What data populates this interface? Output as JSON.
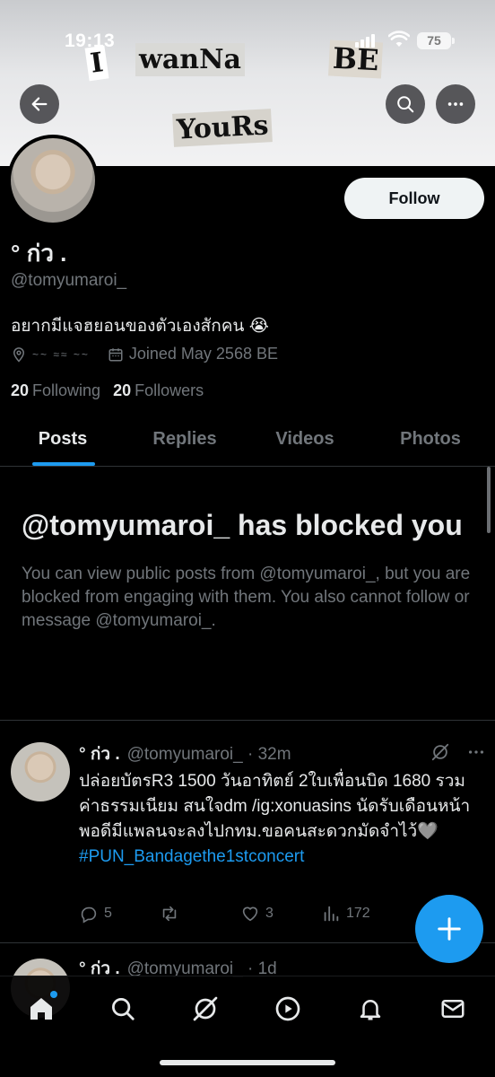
{
  "status_bar": {
    "time": "19:13",
    "battery": "75"
  },
  "banner": {
    "words": [
      "I",
      "wanna",
      "BE",
      "yours"
    ],
    "display": [
      "I",
      "wanNa",
      "BE",
      "YouRs"
    ]
  },
  "profile": {
    "name": "° ก่ว .",
    "handle": "@tomyumaroi_",
    "bio": "อยากมีแจฮยอนของตัวเองสักคน 😭",
    "location": "~~ ≈≈ ~~",
    "joined": "Joined May 2568 BE",
    "following_count": "20",
    "following_label": "Following",
    "followers_count": "20",
    "followers_label": "Followers",
    "follow_label": "Follow"
  },
  "tabs": [
    {
      "label": "Posts",
      "active": true
    },
    {
      "label": "Replies",
      "active": false
    },
    {
      "label": "Videos",
      "active": false
    },
    {
      "label": "Photos",
      "active": false
    }
  ],
  "blocked": {
    "title": "@tomyumaroi_ has blocked you",
    "message": "You can view public posts from @tomyumaroi_, but you are blocked from engaging with them. You also cannot follow or message @tomyumaroi_."
  },
  "tweets": [
    {
      "name": "° ก่ว .",
      "handle": "@tomyumaroi_",
      "time": "· 32m",
      "text": "ปล่อยบัตรR3 1500 วันอาทิตย์ 2ใบเพื่อนบิด 1680 รวมค่าธรรมเนียม สนใจdm /ig:xonuasins นัดรับเดือนหน้าพอดีมีแพลนจะลงไปกทม.ขอคนสะดวกมัดจำไว้🩶",
      "hashtag": "#PUN_Bandagethe1stconcert",
      "replies": "5",
      "reposts": "",
      "likes": "3",
      "views": "172"
    },
    {
      "name": "° ก่ว .",
      "handle": "@tomyumaroi_",
      "time": "· 1d"
    }
  ],
  "nav": [
    "home-icon",
    "search-icon",
    "grok-icon",
    "video-icon",
    "bell-icon",
    "mail-icon"
  ],
  "colors": {
    "accent": "#1d9bf0",
    "background": "#000000",
    "muted": "#71767b"
  }
}
